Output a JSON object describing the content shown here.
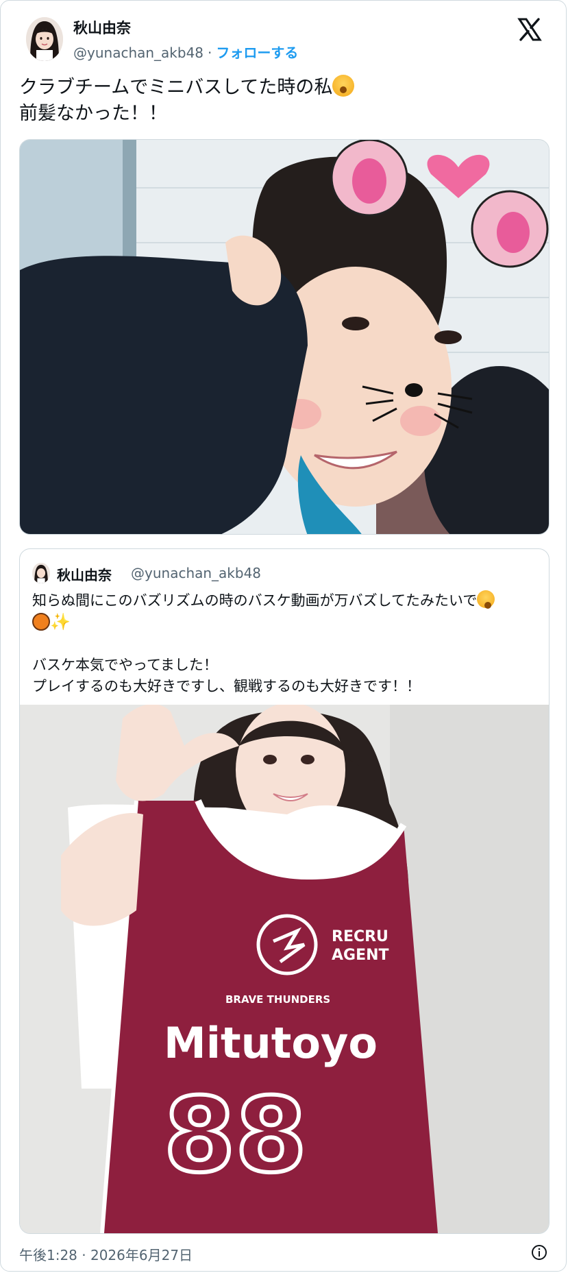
{
  "tweet": {
    "author_name": "秋山由奈",
    "author_handle": "@yunachan_akb48",
    "separator": "·",
    "follow_label": "フォローする",
    "text_line1": "クラブチームでミニバスしてた時の私",
    "text_line2": "前髪なかった！！",
    "emoji": "yawning-face-emoji"
  },
  "quote": {
    "author_name": "秋山由奈",
    "author_handle": "@yunachan_akb48",
    "line1": "知らぬ間にこのバズリズムの時のバスケ動画が万バズしてたみたいで",
    "line3": "バスケ本気でやってました！",
    "line4": "プレイするのも大好きですし、観戦するのも大好きです！！",
    "emojis": [
      "yawning-face-emoji",
      "basketball-emoji",
      "sparkles-emoji"
    ]
  },
  "footer": {
    "timestamp": "午後1:28 · 2026年6月27日",
    "info_icon": "info-icon"
  },
  "colors": {
    "accent": "#1d9bf0",
    "text": "#0f1419",
    "muted": "#536471",
    "border": "#cfd9de",
    "jersey": "#8e1f3e"
  }
}
